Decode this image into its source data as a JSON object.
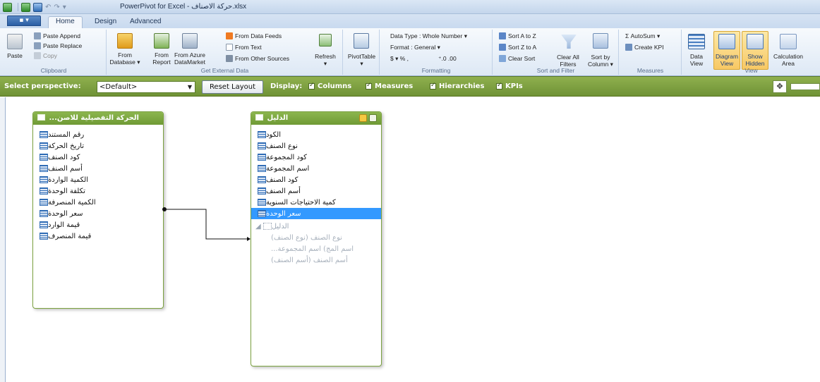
{
  "window": {
    "title": "PowerPivot for Excel - حركة الاصناف.xlsx"
  },
  "tabs": {
    "file": "▪ ▾",
    "home": "Home",
    "design": "Design",
    "advanced": "Advanced"
  },
  "ribbon": {
    "clipboard": {
      "label": "Clipboard",
      "paste": "Paste",
      "paste_append": "Paste Append",
      "paste_replace": "Paste Replace",
      "copy": "Copy"
    },
    "external": {
      "label": "Get External Data",
      "from_database_1": "From",
      "from_database_2": "Database ▾",
      "from_report_1": "From",
      "from_report_2": "Report",
      "from_azure_1": "From Azure",
      "from_azure_2": "DataMarket",
      "from_data_feeds": "From Data Feeds",
      "from_text": "From Text",
      "from_other_sources": "From Other Sources",
      "refresh": "Refresh",
      "refresh_arrow": "▾"
    },
    "pivot": {
      "label": "PivotTable",
      "arrow": "▾"
    },
    "formatting": {
      "label": "Formatting",
      "data_type": "Data Type : Whole Number ▾",
      "format": "Format : General ▾",
      "currency": "$ ▾ % ,",
      "decimals": "⁺.0  .00"
    },
    "sort": {
      "label": "Sort and Filter",
      "sort_a_z": "Sort A to Z",
      "sort_z_a": "Sort Z to A",
      "clear_sort": "Clear Sort",
      "clear_all_1": "Clear All",
      "clear_all_2": "Filters",
      "sort_by_1": "Sort by",
      "sort_by_2": "Column ▾"
    },
    "measures": {
      "label": "Measures",
      "autosum": "Σ AutoSum ▾",
      "create_kpi": "Create KPI"
    },
    "view": {
      "label": "View",
      "data_view_1": "Data",
      "data_view_2": "View",
      "diagram_view_1": "Diagram",
      "diagram_view_2": "View",
      "show_hidden_1": "Show",
      "show_hidden_2": "Hidden",
      "calc_area_1": "Calculation",
      "calc_area_2": "Area"
    }
  },
  "perspective": {
    "label": "Select perspective:",
    "selected": "<Default>",
    "reset_layout": "Reset Layout",
    "display_label": "Display:",
    "columns": "Columns",
    "measures": "Measures",
    "hierarchies": "Hierarchies",
    "kpis": "KPIs"
  },
  "tables": {
    "left": {
      "name": "...الحركة التفصيلية للاصن",
      "columns": [
        "رقم المستند",
        "تاريخ الحركة",
        "كود الصنف",
        "أسم الصنف",
        "الكمية الواردة",
        "تكلفة الوحدة",
        "الكمية المنصرفة",
        "سعر الوحدة",
        "قيمة الوارد",
        "قيمة المنصرف"
      ]
    },
    "right": {
      "name": "الدليل",
      "columns": [
        "الكود",
        "نوع الصنف",
        "كود المجموعة",
        "اسم المجموعة",
        "كود الصنف",
        "أسم الصنف",
        "كمية الاحتياجات السنوية",
        "سعر الوحدة"
      ],
      "hierarchy": "الدليل",
      "levels": [
        "(نوع الصنف) نوع الصنف",
        "...اسم المج) اسم المجموعة",
        "(أسم الصنف) أسم الصنف"
      ]
    }
  }
}
